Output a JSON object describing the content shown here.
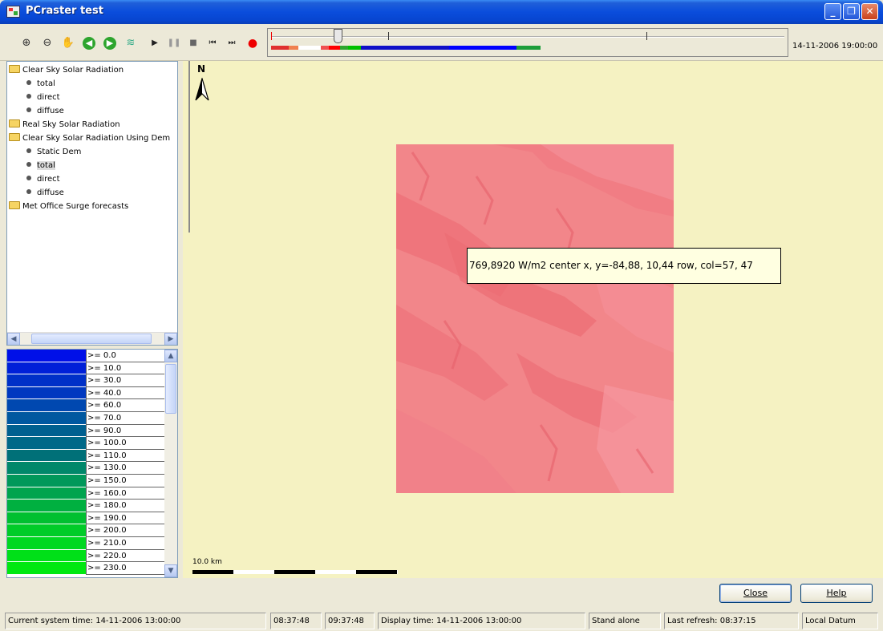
{
  "window": {
    "title": "PCraster test"
  },
  "toolbar": {
    "timestamp": "14-11-2006 19:00:00",
    "timeline_colors": [
      "#e03030",
      "#f08050",
      "#ffffff",
      "#f05050",
      "#ff0000",
      "#2ea52e",
      "#00c000",
      "#1010c8",
      "#0000ff",
      "#1d9e3b"
    ]
  },
  "tree": {
    "items": [
      {
        "type": "folder",
        "label": "Clear Sky Solar Radiation"
      },
      {
        "type": "leaf",
        "label": "total"
      },
      {
        "type": "leaf",
        "label": "direct"
      },
      {
        "type": "leaf",
        "label": "diffuse"
      },
      {
        "type": "folder",
        "label": "Real Sky Solar Radiation"
      },
      {
        "type": "folder",
        "label": "Clear Sky Solar Radiation Using Dem"
      },
      {
        "type": "leaf",
        "label": "Static Dem"
      },
      {
        "type": "leaf",
        "label": "total",
        "selected": true
      },
      {
        "type": "leaf",
        "label": "direct"
      },
      {
        "type": "leaf",
        "label": "diffuse"
      },
      {
        "type": "folder",
        "label": "Met Office Surge forecasts"
      }
    ]
  },
  "legend": {
    "rows": [
      {
        "label": ">= 0.0",
        "color": "#0010E8"
      },
      {
        "label": ">= 10.0",
        "color": "#0020D8"
      },
      {
        "label": ">= 30.0",
        "color": "#0030C8"
      },
      {
        "label": ">= 40.0",
        "color": "#0038C0"
      },
      {
        "label": ">= 60.0",
        "color": "#0048B0"
      },
      {
        "label": ">= 70.0",
        "color": "#0058A0"
      },
      {
        "label": ">= 90.0",
        "color": "#006090"
      },
      {
        "label": ">= 100.0",
        "color": "#006888"
      },
      {
        "label": ">= 110.0",
        "color": "#007078"
      },
      {
        "label": ">= 130.0",
        "color": "#00886A"
      },
      {
        "label": ">= 150.0",
        "color": "#00985A"
      },
      {
        "label": ">= 160.0",
        "color": "#00A44E"
      },
      {
        "label": ">= 180.0",
        "color": "#00B040"
      },
      {
        "label": ">= 190.0",
        "color": "#00C030"
      },
      {
        "label": ">= 200.0",
        "color": "#00CC28"
      },
      {
        "label": ">= 210.0",
        "color": "#00D820"
      },
      {
        "label": ">= 220.0",
        "color": "#00E018"
      },
      {
        "label": ">= 230.0",
        "color": "#00E810"
      }
    ]
  },
  "map": {
    "north_label": "N",
    "tooltip": "769,8920 W/m2 center x, y=-84,88, 10,44 row, col=57, 47",
    "scale_label": "10.0 km",
    "background_color": "#F5F2C2",
    "raster_color": "#F2868A"
  },
  "buttons": {
    "close_label": "Close",
    "help_label": "Help"
  },
  "status": {
    "system_time": "Current system time: 14-11-2006 13:00:00",
    "time1": "08:37:48",
    "time2": "09:37:48",
    "display_time": "Display time: 14-11-2006 13:00:00",
    "mode": "Stand alone",
    "last_refresh": "Last refresh: 08:37:15",
    "datum": "Local Datum"
  }
}
